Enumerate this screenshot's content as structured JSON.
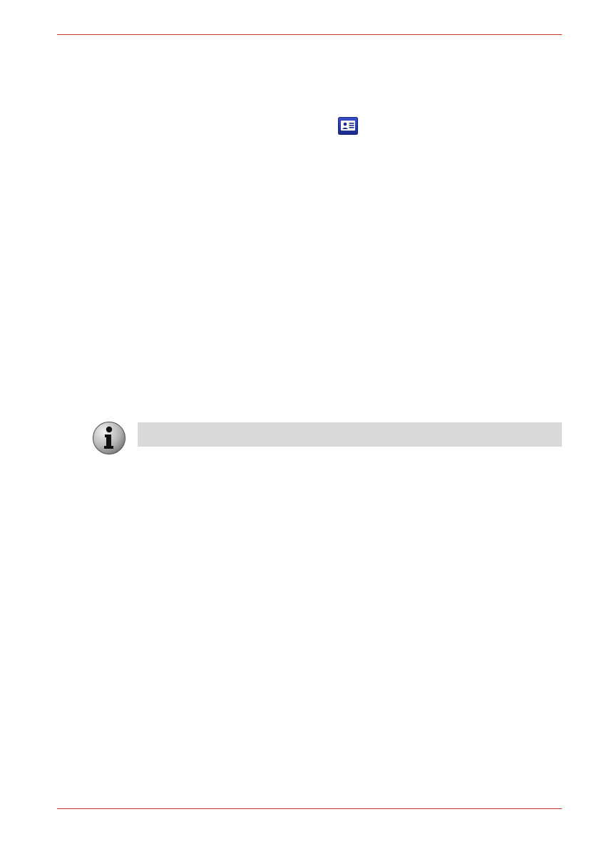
{
  "header": {
    "rule_color": "#c0392b"
  },
  "icons": {
    "inline_icon": "id-card-icon",
    "note_icon": "info-icon"
  },
  "note": {
    "bar_color": "#d9d9d9"
  },
  "footer": {
    "rule_color": "#c0392b"
  }
}
